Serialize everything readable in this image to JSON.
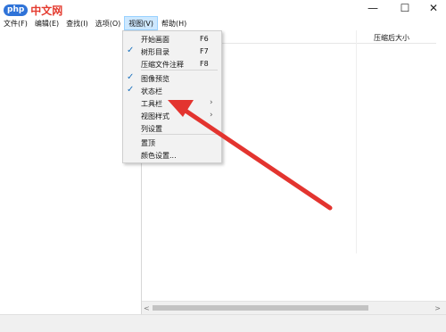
{
  "logo": {
    "badge": "php",
    "text": "中文网"
  },
  "window": {
    "min_icon": "minimize-icon",
    "max_icon": "maximize-icon",
    "close_icon": "close-icon"
  },
  "menubar": {
    "items": [
      {
        "label": "文件(F)"
      },
      {
        "label": "编辑(E)"
      },
      {
        "label": "查找(I)"
      },
      {
        "label": "选项(O)"
      },
      {
        "label": "视图(V)"
      },
      {
        "label": "帮助(H)"
      }
    ]
  },
  "list": {
    "column_header": "压缩后大小"
  },
  "view_menu": {
    "items": [
      {
        "label": "开始画面",
        "shortcut": "F6",
        "checked": false
      },
      {
        "label": "树形目录",
        "shortcut": "F7",
        "checked": true
      },
      {
        "label": "压缩文件注释",
        "shortcut": "F8",
        "checked": false
      },
      {
        "label": "图像预览",
        "checked": true
      },
      {
        "label": "状态栏",
        "checked": true
      },
      {
        "label": "工具栏",
        "has_submenu": true
      },
      {
        "label": "视图样式",
        "has_submenu": true
      },
      {
        "label": "列设置",
        "has_submenu": true
      },
      {
        "label": "置顶"
      },
      {
        "label": "颜色设置..."
      }
    ]
  },
  "annotation": {
    "arrow_color": "#e3342f"
  },
  "colors": {
    "check": "#1e73be",
    "menu_bg": "#f2f2f2",
    "menubar_active": "#cde8ff"
  }
}
